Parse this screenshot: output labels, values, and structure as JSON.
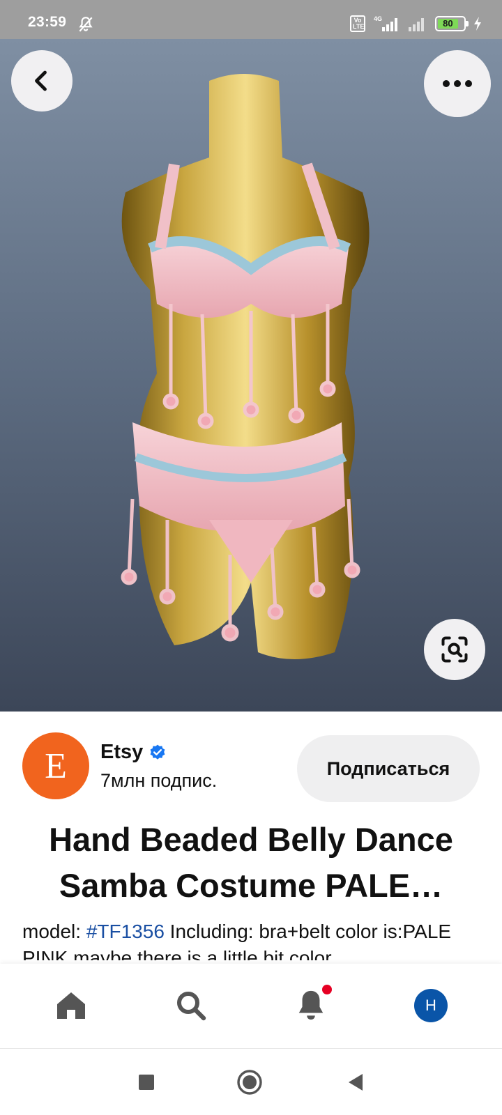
{
  "status_bar": {
    "time": "23:59",
    "volte": "Vo LTE",
    "network": "4G",
    "battery": "80",
    "battery_level": 0.8,
    "battery_color": "#7ed957"
  },
  "hero": {
    "back_icon": "chevron-left-icon",
    "more_icon": "more-horizontal-icon",
    "lens_icon": "visual-search-icon"
  },
  "creator": {
    "avatar_letter": "E",
    "avatar_color": "#f1641e",
    "name": "Etsy",
    "verified_color": "#1877f2",
    "followers": "7млн подпис.",
    "follow_label": "Подписаться"
  },
  "pin": {
    "title_line1": "Hand Beaded Belly Dance",
    "title_line2": "Samba Costume PALE…",
    "desc_prefix": "model: ",
    "desc_tag": "#TF1356",
    "desc_rest": " Including: bra+belt color is:PALE PINK maybe there is a little bit color"
  },
  "bottom_nav": {
    "home_icon": "home-icon",
    "search_icon": "search-icon",
    "notifications_icon": "bell-icon",
    "profile_letter": "H",
    "profile_color": "#0a55a8",
    "notification_dot_color": "#e60023"
  },
  "system_nav": {
    "recents_icon": "square-icon",
    "home_icon": "circle-icon",
    "back_icon": "triangle-back-icon"
  }
}
